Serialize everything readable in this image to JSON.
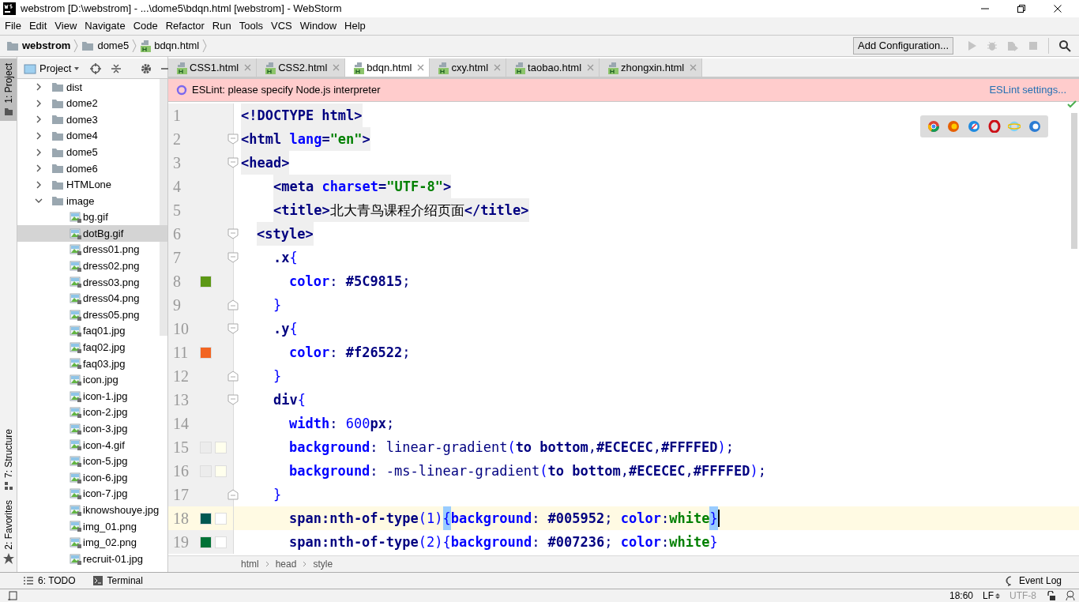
{
  "window": {
    "title": "webstrom [D:\\webstrom] - ...\\dome5\\bdqn.html [webstrom] - WebStorm"
  },
  "menu": [
    "File",
    "Edit",
    "View",
    "Navigate",
    "Code",
    "Refactor",
    "Run",
    "Tools",
    "VCS",
    "Window",
    "Help"
  ],
  "navbar": {
    "path": [
      {
        "label": "webstrom",
        "kind": "folder"
      },
      {
        "label": "dome5",
        "kind": "folder"
      },
      {
        "label": "bdqn.html",
        "kind": "file"
      }
    ],
    "config_button": "Add Configuration..."
  },
  "side_tabs": [
    {
      "label": "1: Project",
      "selected": true,
      "kind": "folder"
    },
    {
      "label": "7: Structure",
      "selected": false,
      "kind": "structure"
    },
    {
      "label": "2: Favorites",
      "selected": false,
      "kind": "star"
    }
  ],
  "project": {
    "title": "Project",
    "tree": [
      {
        "label": "dist",
        "kind": "folder",
        "expanded": false,
        "selected": false
      },
      {
        "label": "dome2",
        "kind": "folder",
        "expanded": false,
        "selected": false
      },
      {
        "label": "dome3",
        "kind": "folder",
        "expanded": false,
        "selected": false
      },
      {
        "label": "dome4",
        "kind": "folder",
        "expanded": false,
        "selected": false
      },
      {
        "label": "dome5",
        "kind": "folder",
        "expanded": false,
        "selected": false
      },
      {
        "label": "dome6",
        "kind": "folder",
        "expanded": false,
        "selected": false
      },
      {
        "label": "HTMLone",
        "kind": "folder",
        "expanded": false,
        "selected": false
      },
      {
        "label": "image",
        "kind": "folder",
        "expanded": true,
        "selected": false,
        "children": [
          {
            "label": "bg.gif",
            "kind": "image",
            "selected": false
          },
          {
            "label": "dotBg.gif",
            "kind": "image",
            "selected": true
          },
          {
            "label": "dress01.png",
            "kind": "image",
            "selected": false
          },
          {
            "label": "dress02.png",
            "kind": "image",
            "selected": false
          },
          {
            "label": "dress03.png",
            "kind": "image",
            "selected": false
          },
          {
            "label": "dress04.png",
            "kind": "image",
            "selected": false
          },
          {
            "label": "dress05.png",
            "kind": "image",
            "selected": false
          },
          {
            "label": "faq01.jpg",
            "kind": "image",
            "selected": false
          },
          {
            "label": "faq02.jpg",
            "kind": "image",
            "selected": false
          },
          {
            "label": "faq03.jpg",
            "kind": "image",
            "selected": false
          },
          {
            "label": "icon.jpg",
            "kind": "image",
            "selected": false
          },
          {
            "label": "icon-1.jpg",
            "kind": "image",
            "selected": false
          },
          {
            "label": "icon-2.jpg",
            "kind": "image",
            "selected": false
          },
          {
            "label": "icon-3.jpg",
            "kind": "image",
            "selected": false
          },
          {
            "label": "icon-4.gif",
            "kind": "image",
            "selected": false
          },
          {
            "label": "icon-5.jpg",
            "kind": "image",
            "selected": false
          },
          {
            "label": "icon-6.jpg",
            "kind": "image",
            "selected": false
          },
          {
            "label": "icon-7.jpg",
            "kind": "image",
            "selected": false
          },
          {
            "label": "iknowshouye.jpg",
            "kind": "image",
            "selected": false
          },
          {
            "label": "img_01.png",
            "kind": "image",
            "selected": false
          },
          {
            "label": "img_02.png",
            "kind": "image",
            "selected": false
          },
          {
            "label": "recruit-01.jpg",
            "kind": "image",
            "selected": false
          }
        ]
      }
    ]
  },
  "tabs": [
    {
      "label": "CSS1.html",
      "selected": false
    },
    {
      "label": "CSS2.html",
      "selected": false
    },
    {
      "label": "bdqn.html",
      "selected": true
    },
    {
      "label": "cxy.html",
      "selected": false
    },
    {
      "label": "taobao.html",
      "selected": false
    },
    {
      "label": "zhongxin.html",
      "selected": false
    }
  ],
  "banner": {
    "message": "ESLint: please specify Node.js interpreter",
    "link": "ESLint settings..."
  },
  "editor": {
    "lines": [
      {
        "number": "1",
        "kind": "top",
        "current": false,
        "tokens": [
          {
            "kind": "tag",
            "text": "<!DOCTYPE html>"
          }
        ]
      },
      {
        "number": "2",
        "kind": "top",
        "current": false,
        "fold": {
          "kind": "start"
        },
        "tokens": [
          {
            "kind": "tag",
            "text": "<html "
          },
          {
            "kind": "attr",
            "text": "lang"
          },
          {
            "kind": "tag",
            "text": "="
          },
          {
            "kind": "str",
            "text": "\"en\""
          },
          {
            "kind": "tag",
            "text": ">"
          }
        ]
      },
      {
        "number": "3",
        "kind": "top",
        "current": false,
        "fold": {
          "kind": "start"
        },
        "tokens": [
          {
            "kind": "tag",
            "text": "<head>"
          }
        ]
      },
      {
        "number": "4",
        "kind": "child",
        "current": false,
        "tokens": [
          {
            "kind": "tag",
            "text": "<meta "
          },
          {
            "kind": "attr",
            "text": "charset"
          },
          {
            "kind": "tag",
            "text": "="
          },
          {
            "kind": "str",
            "text": "\"UTF-8\""
          },
          {
            "kind": "tag",
            "text": ">"
          }
        ]
      },
      {
        "number": "5",
        "kind": "child",
        "current": false,
        "tokens": [
          {
            "kind": "tag",
            "text": "<title>"
          },
          {
            "kind": "text",
            "text": "北大青鸟课程介绍页面"
          },
          {
            "kind": "tag",
            "text": "</title>"
          }
        ]
      },
      {
        "number": "6",
        "kind": "style",
        "current": false,
        "fold": {
          "kind": "start"
        },
        "tokens": [
          {
            "kind": "tag",
            "text": "<style>"
          }
        ]
      },
      {
        "number": "7",
        "kind": "rule",
        "current": false,
        "fold": {
          "kind": "start"
        },
        "tokens": [
          {
            "kind": "sel",
            "text": ".x"
          },
          {
            "kind": "brace",
            "text": "{"
          }
        ]
      },
      {
        "number": "8",
        "kind": "decl",
        "current": false,
        "swatches": [
          {
            "color": "#5c9815"
          }
        ],
        "tokens": [
          {
            "kind": "prop",
            "text": "color"
          },
          {
            "kind": "punct",
            "text": ": "
          },
          {
            "kind": "val",
            "text": "#5C9815"
          },
          {
            "kind": "punct",
            "text": ";"
          }
        ]
      },
      {
        "number": "9",
        "kind": "rule",
        "current": false,
        "fold": {
          "kind": "end"
        },
        "tokens": [
          {
            "kind": "brace",
            "text": "}"
          }
        ]
      },
      {
        "number": "10",
        "kind": "rule",
        "current": false,
        "fold": {
          "kind": "start"
        },
        "tokens": [
          {
            "kind": "sel",
            "text": ".y"
          },
          {
            "kind": "brace",
            "text": "{"
          }
        ]
      },
      {
        "number": "11",
        "kind": "decl",
        "current": false,
        "swatches": [
          {
            "color": "#f26522"
          }
        ],
        "tokens": [
          {
            "kind": "prop",
            "text": "color"
          },
          {
            "kind": "punct",
            "text": ": "
          },
          {
            "kind": "val",
            "text": "#f26522"
          },
          {
            "kind": "punct",
            "text": ";"
          }
        ]
      },
      {
        "number": "12",
        "kind": "rule",
        "current": false,
        "fold": {
          "kind": "end"
        },
        "tokens": [
          {
            "kind": "brace",
            "text": "}"
          }
        ]
      },
      {
        "number": "13",
        "kind": "rule",
        "current": false,
        "fold": {
          "kind": "start"
        },
        "tokens": [
          {
            "kind": "sel",
            "text": "div"
          },
          {
            "kind": "brace",
            "text": "{"
          }
        ]
      },
      {
        "number": "14",
        "kind": "decl",
        "current": false,
        "tokens": [
          {
            "kind": "prop",
            "text": "width"
          },
          {
            "kind": "punct",
            "text": ": "
          },
          {
            "kind": "num",
            "text": "600"
          },
          {
            "kind": "val",
            "text": "px"
          },
          {
            "kind": "punct",
            "text": ";"
          }
        ]
      },
      {
        "number": "15",
        "kind": "decl",
        "current": false,
        "swatches": [
          {
            "color": "#ececec"
          },
          {
            "color": "#ffffed"
          }
        ],
        "tokens": [
          {
            "kind": "prop",
            "text": "background"
          },
          {
            "kind": "punct",
            "text": ": "
          },
          {
            "kind": "fn",
            "text": "linear-gradient"
          },
          {
            "kind": "brace",
            "text": "("
          },
          {
            "kind": "val",
            "text": "to bottom"
          },
          {
            "kind": "punct",
            "text": ","
          },
          {
            "kind": "val",
            "text": "#ECECEC"
          },
          {
            "kind": "punct",
            "text": ","
          },
          {
            "kind": "val",
            "text": "#FFFFED"
          },
          {
            "kind": "brace",
            "text": ")"
          },
          {
            "kind": "punct",
            "text": ";"
          }
        ]
      },
      {
        "number": "16",
        "kind": "decl",
        "current": false,
        "swatches": [
          {
            "color": "#ececec"
          },
          {
            "color": "#ffffed"
          }
        ],
        "tokens": [
          {
            "kind": "prop",
            "text": "background"
          },
          {
            "kind": "punct",
            "text": ": "
          },
          {
            "kind": "fn",
            "text": "-ms-linear-gradient"
          },
          {
            "kind": "brace",
            "text": "("
          },
          {
            "kind": "val",
            "text": "to bottom"
          },
          {
            "kind": "punct",
            "text": ","
          },
          {
            "kind": "val",
            "text": "#ECECEC"
          },
          {
            "kind": "punct",
            "text": ","
          },
          {
            "kind": "val",
            "text": "#FFFFED"
          },
          {
            "kind": "brace",
            "text": ")"
          },
          {
            "kind": "punct",
            "text": ";"
          }
        ]
      },
      {
        "number": "17",
        "kind": "rule",
        "current": false,
        "fold": {
          "kind": "end"
        },
        "tokens": [
          {
            "kind": "brace",
            "text": "}"
          }
        ]
      },
      {
        "number": "18",
        "kind": "decl",
        "current": true,
        "swatches": [
          {
            "color": "#005952"
          },
          {
            "color": "#ffffff"
          }
        ],
        "tokens": [
          {
            "kind": "sel",
            "text": "span:nth-of-type"
          },
          {
            "kind": "brace",
            "text": "("
          },
          {
            "kind": "num",
            "text": "1"
          },
          {
            "kind": "brace",
            "text": ")"
          },
          {
            "kind": "match",
            "text": "{"
          },
          {
            "kind": "prop",
            "text": "background"
          },
          {
            "kind": "punct",
            "text": ": "
          },
          {
            "kind": "val",
            "text": "#005952"
          },
          {
            "kind": "punct",
            "text": "; "
          },
          {
            "kind": "prop",
            "text": "color"
          },
          {
            "kind": "punct",
            "text": ":"
          },
          {
            "kind": "word",
            "text": "white"
          },
          {
            "kind": "match",
            "text": "}"
          }
        ]
      },
      {
        "number": "19",
        "kind": "decl",
        "current": false,
        "swatches": [
          {
            "color": "#007236"
          },
          {
            "color": "#ffffff"
          }
        ],
        "tokens": [
          {
            "kind": "sel",
            "text": "span:nth-of-type"
          },
          {
            "kind": "brace",
            "text": "("
          },
          {
            "kind": "num",
            "text": "2"
          },
          {
            "kind": "brace",
            "text": ")"
          },
          {
            "kind": "brace",
            "text": "{"
          },
          {
            "kind": "prop",
            "text": "background"
          },
          {
            "kind": "punct",
            "text": ": "
          },
          {
            "kind": "val",
            "text": "#007236"
          },
          {
            "kind": "punct",
            "text": "; "
          },
          {
            "kind": "prop",
            "text": "color"
          },
          {
            "kind": "punct",
            "text": ":"
          },
          {
            "kind": "word",
            "text": "white"
          },
          {
            "kind": "brace",
            "text": "}"
          }
        ]
      }
    ],
    "breadcrumb": [
      "html",
      "head",
      "style"
    ]
  },
  "bottom_tabs": [
    {
      "label": "6: TODO",
      "kind": "list"
    },
    {
      "label": "Terminal",
      "kind": "terminal"
    }
  ],
  "event_log": "Event Log",
  "status_bar": {
    "position": "18:60",
    "line_separator": "LF",
    "encoding": "UTF-8"
  }
}
